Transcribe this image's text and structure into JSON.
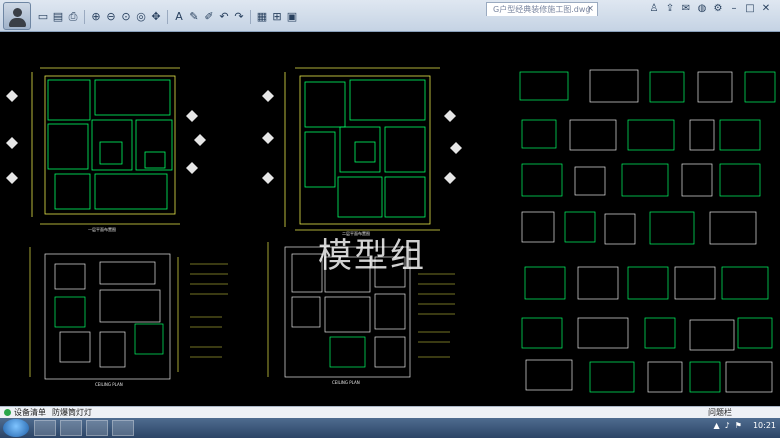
{
  "window": {
    "file_tab_title": "G户型经典装修施工图.dwg"
  },
  "toolbar": {
    "buttons": [
      "open-icon",
      "save-icon",
      "print-icon",
      "zoom-in-icon",
      "zoom-out-icon",
      "zoom-window-icon",
      "zoom-extents-icon",
      "pan-icon",
      "text-icon",
      "pen-icon",
      "pencil-icon",
      "undo-icon",
      "redo-icon",
      "layer-icon",
      "measure-icon",
      "grid-icon"
    ]
  },
  "right_icons": [
    "users-icon",
    "share-icon",
    "chat-icon",
    "globe-icon",
    "settings-icon",
    "minimize-icon",
    "maximize-icon",
    "close-icon"
  ],
  "drawing": {
    "watermark": "模型组",
    "plan_titles": [
      "一层平面布置图",
      "二层平面布置图",
      "CEILING PLAN",
      "CEILING PLAN"
    ]
  },
  "status": {
    "item1": "设备清单",
    "item2": "防爆筒灯灯",
    "right": "问题栏"
  },
  "taskbar": {
    "clock": "10:21"
  },
  "colors": {
    "canvas": "#000000",
    "line_green": "#00ff66",
    "line_yellow": "#e8e84a",
    "line_white": "#e6e6e6"
  }
}
